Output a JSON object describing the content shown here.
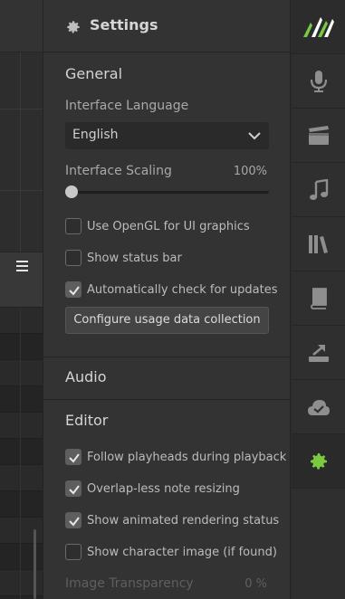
{
  "header": {
    "title": "Settings"
  },
  "general": {
    "title": "General",
    "language_label": "Interface Language",
    "language_value": "English",
    "scaling_label": "Interface Scaling",
    "scaling_value": "100%",
    "scaling_fraction": 0.0,
    "checkboxes": [
      {
        "label": "Use OpenGL for UI graphics",
        "checked": false
      },
      {
        "label": "Show status bar",
        "checked": false
      },
      {
        "label": "Automatically check for updates",
        "checked": true
      }
    ],
    "usage_button": "Configure usage data collection"
  },
  "audio": {
    "title": "Audio"
  },
  "editor": {
    "title": "Editor",
    "checkboxes": [
      {
        "label": "Follow playheads during playback",
        "checked": true
      },
      {
        "label": "Overlap-less note resizing",
        "checked": true
      },
      {
        "label": "Show animated rendering status",
        "checked": true
      },
      {
        "label": "Show character image (if found)",
        "checked": false
      }
    ],
    "transparency_label": "Image Transparency",
    "transparency_value": "0 %",
    "transparency_fraction": 0.0
  },
  "sidebar": {
    "items": [
      {
        "icon": "app-logo-icon",
        "active": false
      },
      {
        "icon": "microphone-icon",
        "active": false
      },
      {
        "icon": "clapperboard-icon",
        "active": false
      },
      {
        "icon": "music-note-icon",
        "active": false
      },
      {
        "icon": "library-icon",
        "active": false
      },
      {
        "icon": "book-icon",
        "active": false
      },
      {
        "icon": "export-icon",
        "active": false
      },
      {
        "icon": "cloud-check-icon",
        "active": false
      },
      {
        "icon": "gear-icon",
        "active": true
      }
    ]
  },
  "colors": {
    "accent": "#7ac943",
    "panel_bg": "#333333",
    "sidebar_icon": "#8e8e8e"
  }
}
